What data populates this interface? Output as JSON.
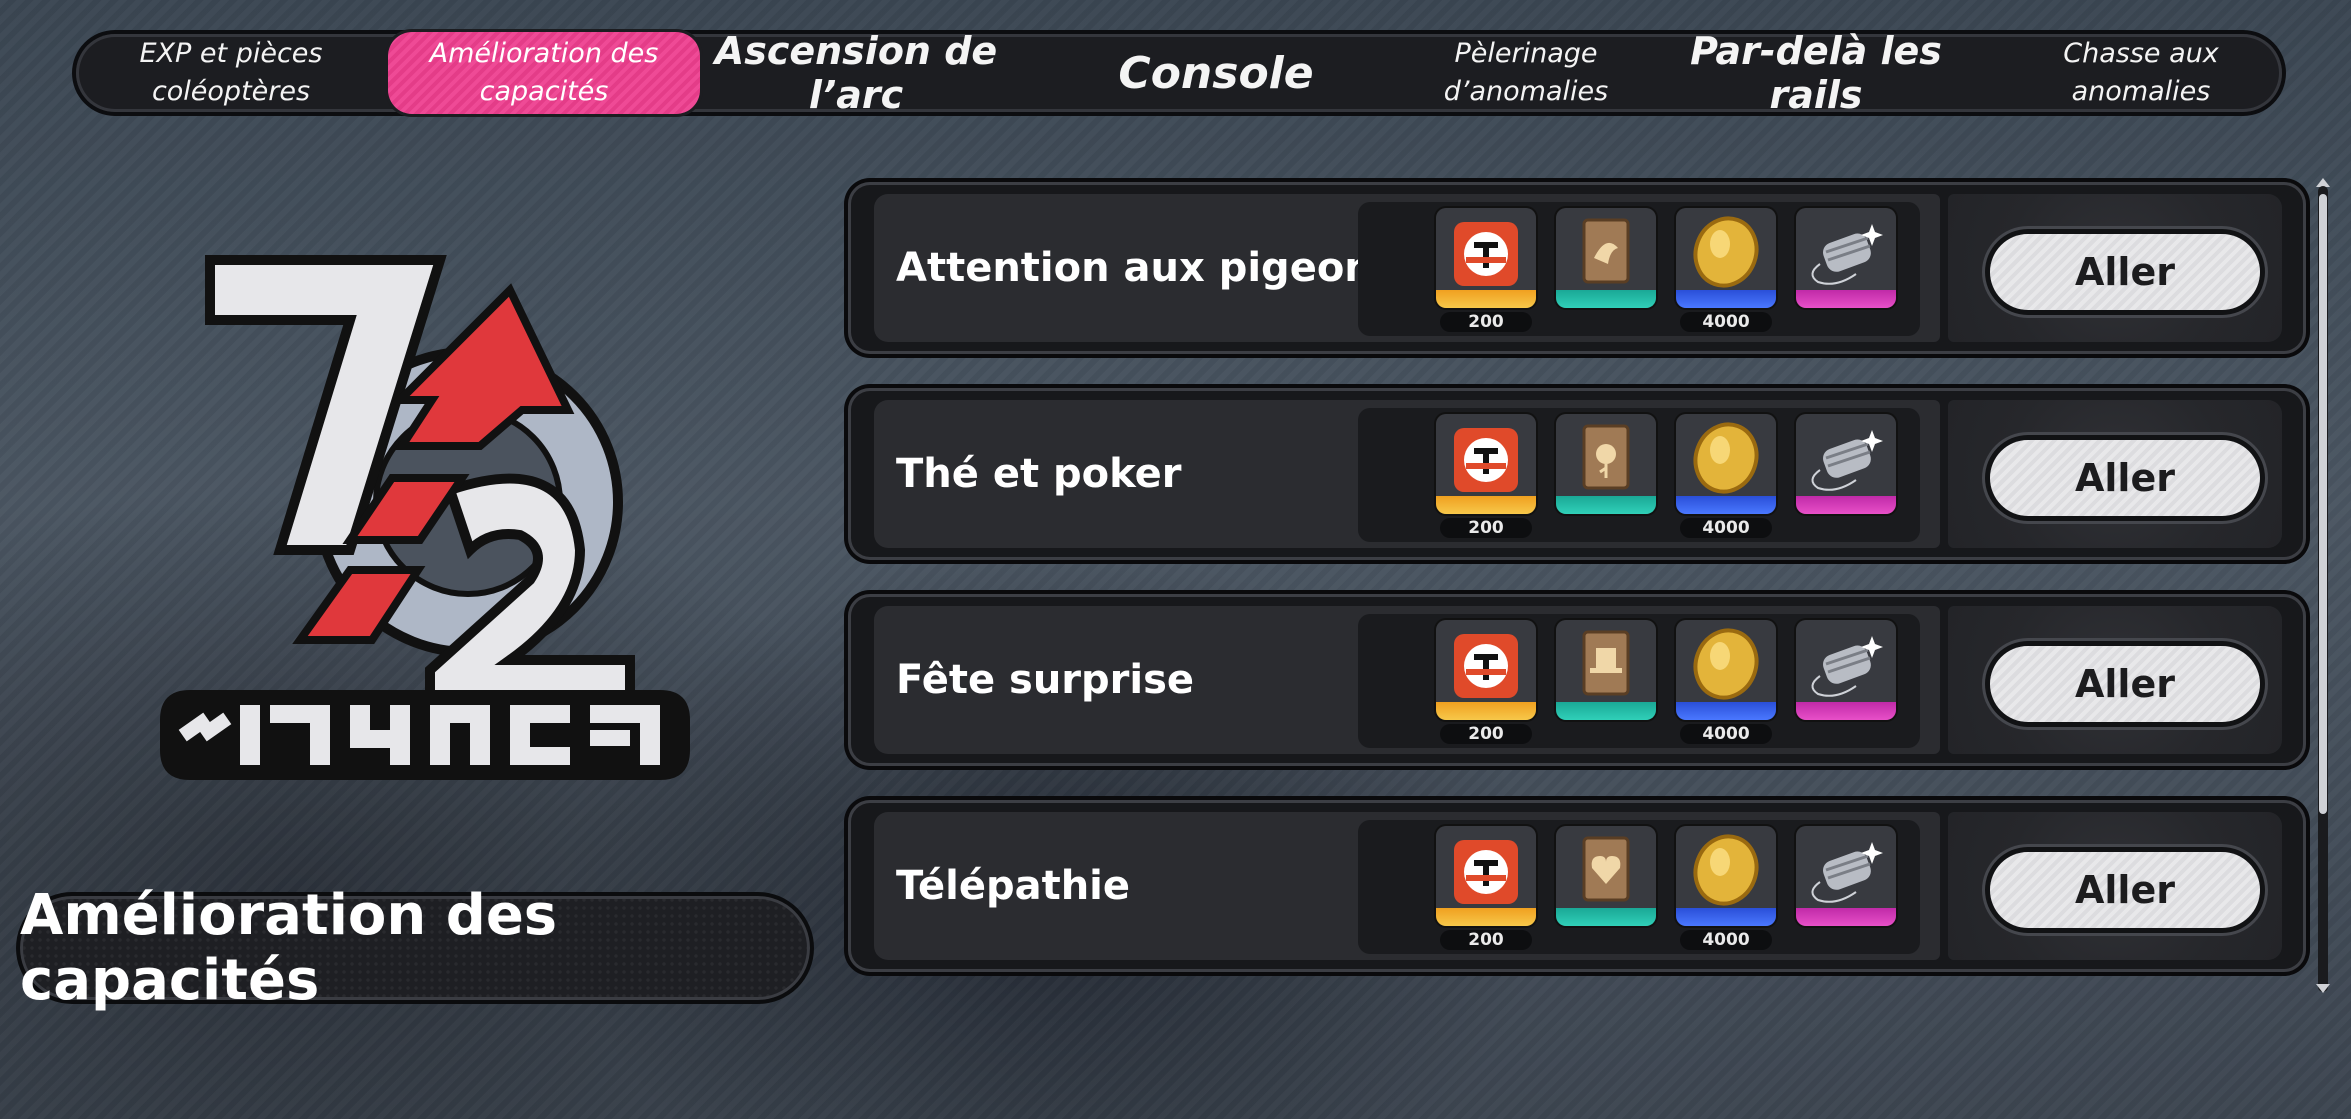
{
  "tabs": [
    {
      "label": "EXP et pièces coléoptères",
      "active": false
    },
    {
      "label": "Amélioration des capacités",
      "active": true
    },
    {
      "label": "Ascension de l’arc",
      "active": false
    },
    {
      "label": "Console",
      "active": false
    },
    {
      "label": "Pèlerinage d’anomalies",
      "active": false
    },
    {
      "label": "Par-delà les rails",
      "active": false
    },
    {
      "label": "Chasse aux anomalies",
      "active": false
    }
  ],
  "page_title": "Amélioration des capacités",
  "accent_color": "#ef4a96",
  "stages": [
    {
      "title": "Attention aux pigeons",
      "go_label": "Aller",
      "rewards": [
        {
          "icon": "hunter-token-icon",
          "quantity": "200"
        },
        {
          "icon": "bird-card-icon",
          "quantity": ""
        },
        {
          "icon": "gold-coin-icon",
          "quantity": "4000"
        },
        {
          "icon": "thread-spool-icon",
          "quantity": ""
        }
      ]
    },
    {
      "title": "Thé et poker",
      "go_label": "Aller",
      "rewards": [
        {
          "icon": "hunter-token-icon",
          "quantity": "200"
        },
        {
          "icon": "rose-card-icon",
          "quantity": ""
        },
        {
          "icon": "gold-coin-icon",
          "quantity": "4000"
        },
        {
          "icon": "thread-spool-icon",
          "quantity": ""
        }
      ]
    },
    {
      "title": "Fête surprise",
      "go_label": "Aller",
      "rewards": [
        {
          "icon": "hunter-token-icon",
          "quantity": "200"
        },
        {
          "icon": "hat-card-icon",
          "quantity": ""
        },
        {
          "icon": "gold-coin-icon",
          "quantity": "4000"
        },
        {
          "icon": "thread-spool-icon",
          "quantity": ""
        }
      ]
    },
    {
      "title": "Télépathie",
      "go_label": "Aller",
      "rewards": [
        {
          "icon": "hunter-token-icon",
          "quantity": "200"
        },
        {
          "icon": "heart-card-icon",
          "quantity": ""
        },
        {
          "icon": "gold-coin-icon",
          "quantity": "4000"
        },
        {
          "icon": "thread-spool-icon",
          "quantity": ""
        }
      ]
    }
  ]
}
